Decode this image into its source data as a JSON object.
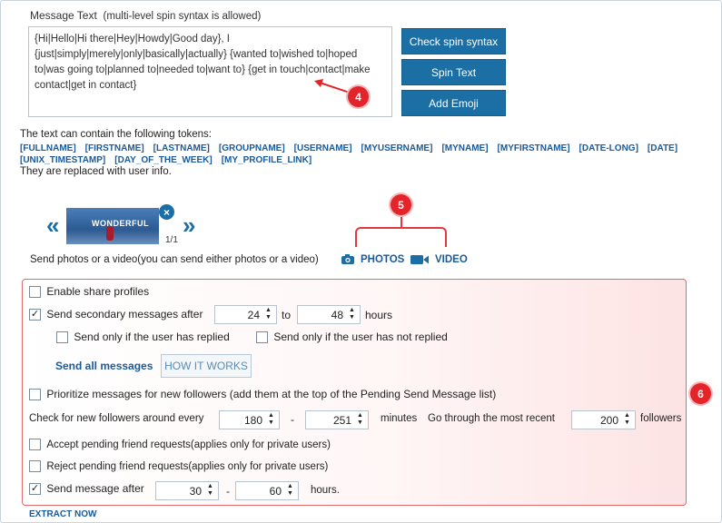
{
  "message": {
    "label": "Message Text",
    "hint": "(multi-level spin syntax is allowed)",
    "text": "{Hi|Hello|Hi there|Hey|Howdy|Good day}, I {just|simply|merely|only|basically|actually} {wanted to|wished to|hoped to|was going to|planned to|needed to|want to} {get in touch|contact|make contact|get in contact}"
  },
  "buttons": {
    "check_spin": "Check spin syntax",
    "spin_text": "Spin Text",
    "add_emoji": "Add Emoji"
  },
  "badges": {
    "b4": "4",
    "b5": "5",
    "b6": "6"
  },
  "tokens": {
    "intro": "The text can contain the following tokens:",
    "items": [
      "[FULLNAME]",
      "[FIRSTNAME]",
      "[LASTNAME]",
      "[GROUPNAME]",
      "[USERNAME]",
      "[MYUSERNAME]",
      "[MYNAME]",
      "[MYFIRSTNAME]",
      "[DATE-LONG]",
      "[DATE]",
      "[UNIX_TIMESTAMP]",
      "[DAY_OF_THE_WEEK]",
      "[MY_PROFILE_LINK]"
    ],
    "replaced": "They are replaced with user info."
  },
  "media": {
    "prev": "«",
    "next": "»",
    "thumb_text": "WONDERFUL",
    "remove": "×",
    "counter": "1/1",
    "send_label": "Send photos or a video(you can send either photos or a video)",
    "photos_label": "PHOTOS",
    "video_label": "VIDEO"
  },
  "options": {
    "enable_share": {
      "label": "Enable share profiles",
      "checked": false
    },
    "send_secondary": {
      "label": "Send secondary messages after",
      "checked": true,
      "from": "24",
      "to_label": "to",
      "to": "48",
      "unit": "hours"
    },
    "only_replied": {
      "label": "Send only if the user has replied",
      "checked": false
    },
    "only_not_replied": {
      "label": "Send only if the user has not replied",
      "checked": false
    },
    "send_all": "Send all messages",
    "how_it_works": "HOW IT WORKS",
    "prioritize": {
      "label": "Prioritize messages for new followers (add them at the top of the Pending Send Message list)",
      "checked": false
    },
    "check_followers": {
      "label": "Check for new followers around every",
      "from": "180",
      "dash": "-",
      "to": "251",
      "unit": "minutes",
      "go_label": "Go through the most recent",
      "recent": "200",
      "recent_unit": "followers"
    },
    "accept_pending": {
      "label": "Accept pending friend requests(applies only for private users)",
      "checked": false
    },
    "reject_pending": {
      "label": "Reject pending friend requests(applies only for private users)",
      "checked": false
    },
    "send_after": {
      "label": "Send message after",
      "checked": true,
      "from": "30",
      "dash": "-",
      "to": "60",
      "unit": "hours."
    }
  },
  "extract": "EXTRACT NOW",
  "colors": {
    "accent": "#1b6fa5",
    "annotation": "#e3242b",
    "link": "#1a5a9a"
  }
}
